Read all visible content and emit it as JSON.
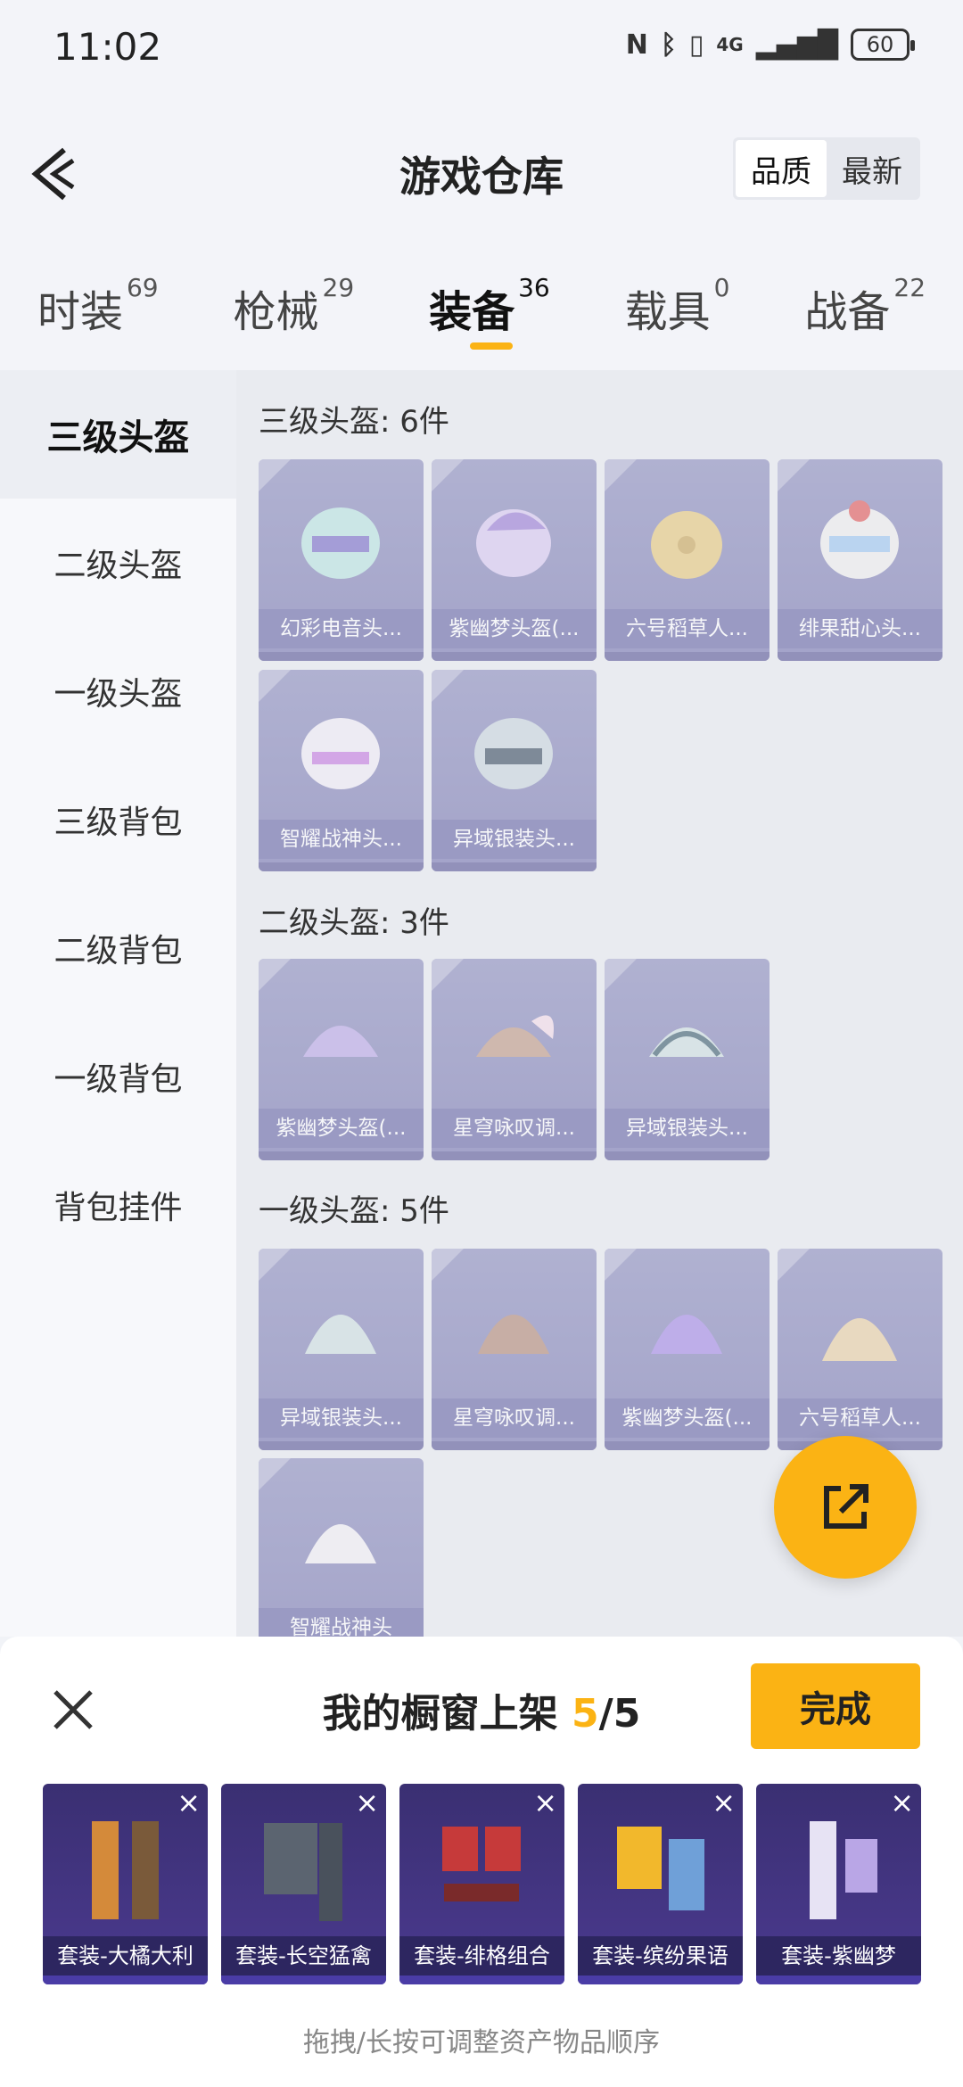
{
  "status": {
    "time": "11:02",
    "network": "4G",
    "battery": "60"
  },
  "header": {
    "title": "游戏仓库",
    "sort_options": [
      {
        "label": "品质",
        "active": true
      },
      {
        "label": "最新",
        "active": false
      }
    ]
  },
  "tabs": [
    {
      "label": "时装",
      "count": "69"
    },
    {
      "label": "枪械",
      "count": "29"
    },
    {
      "label": "装备",
      "count": "36"
    },
    {
      "label": "载具",
      "count": "0"
    },
    {
      "label": "战备",
      "count": "22"
    }
  ],
  "sidebar": {
    "items": [
      "三级头盔",
      "二级头盔",
      "一级头盔",
      "三级背包",
      "二级背包",
      "一级背包",
      "背包挂件"
    ]
  },
  "sections": [
    {
      "title": "三级头盔: 6件",
      "items": [
        "幻彩电音头...",
        "紫幽梦头盔(...",
        "六号稻草人...",
        "绯果甜心头...",
        "智耀战神头...",
        "异域银装头..."
      ]
    },
    {
      "title": "二级头盔: 3件",
      "items": [
        "紫幽梦头盔(...",
        "星穹咏叹调...",
        "异域银装头..."
      ]
    },
    {
      "title": "一级头盔: 5件",
      "items": [
        "异域银装头...",
        "星穹咏叹调...",
        "紫幽梦头盔(...",
        "六号稻草人...",
        "智耀战神头"
      ]
    }
  ],
  "shelf": {
    "title": "我的橱窗上架",
    "current": "5",
    "separator": "/",
    "max": "5",
    "done_label": "完成",
    "items": [
      "套装-大橘大利",
      "套装-长空猛禽",
      "套装-绯格组合",
      "套装-缤纷果语",
      "套装-紫幽梦"
    ],
    "hint": "拖拽/长按可调整资产物品顺序"
  },
  "colors": {
    "accent": "#fbb314",
    "card_name_bg": "#6b69a8",
    "shelf_card_bg": "#3a2f72"
  },
  "icons": {
    "back": "chevron-left-icon",
    "close": "close-icon",
    "share": "share-icon"
  }
}
